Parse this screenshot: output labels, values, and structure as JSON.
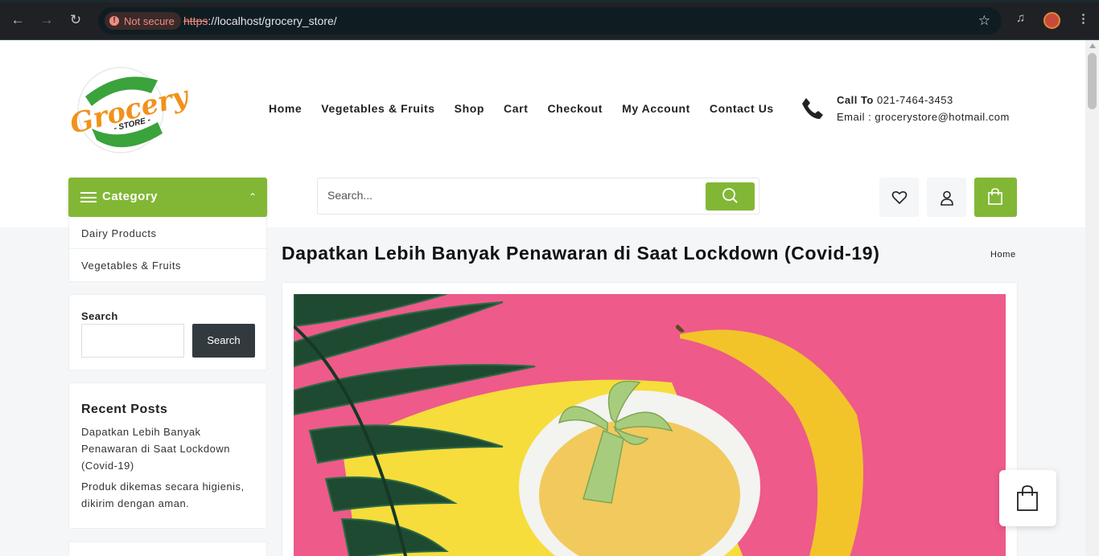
{
  "browser": {
    "security_label": "Not secure",
    "url_scheme": "https",
    "url_rest": "://localhost/grocery_store/"
  },
  "brand": {
    "logo_word": "Grocery",
    "logo_sub": "- STORE -",
    "green": "#82b735",
    "orange": "#f0921c"
  },
  "nav": {
    "items": [
      "Home",
      "Vegetables & Fruits",
      "Shop",
      "Cart",
      "Checkout",
      "My Account",
      "Contact Us"
    ]
  },
  "contact": {
    "call_label": "Call To",
    "phone": "021-7464-3453",
    "email": "Email : grocerystore@hotmail.com"
  },
  "category": {
    "label": "Category",
    "items": [
      "Dairy Products",
      "Vegetables & Fruits"
    ]
  },
  "search": {
    "placeholder": "Search..."
  },
  "sidebar": {
    "search_label": "Search",
    "search_button": "Search",
    "recent_posts_title": "Recent Posts",
    "recent_posts": [
      "Dapatkan Lebih Banyak Penawaran di Saat Lockdown (Covid-19)",
      "Produk dikemas secara higienis, dikirim dengan aman."
    ]
  },
  "post": {
    "title": "Dapatkan Lebih Banyak Penawaran di Saat Lockdown (Covid-19)",
    "breadcrumb": "Home"
  }
}
